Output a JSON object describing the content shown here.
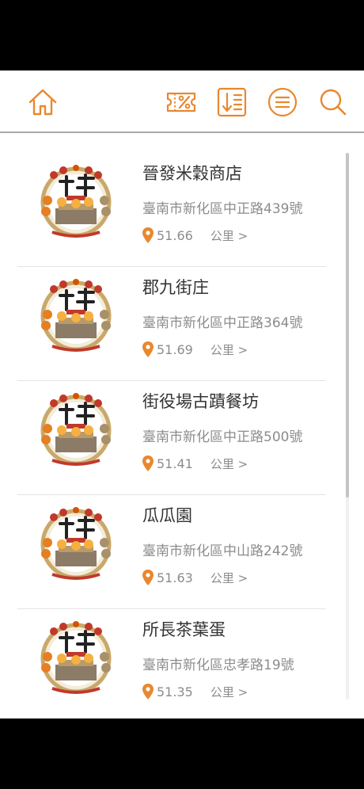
{
  "colors": {
    "accent": "#e8882e",
    "pin": "#e8882e",
    "divider": "#a8a8a8"
  },
  "toolbar": {
    "home_icon": "home-icon",
    "coupon_icon": "coupon-icon",
    "sort_icon": "sort-icon",
    "filter_icon": "filter-icon",
    "search_icon": "search-icon"
  },
  "stores": [
    {
      "name": "晉發米穀商店",
      "address": "臺南市新化區中正路439號",
      "distance": "51.66",
      "unit": "公里 >"
    },
    {
      "name": "郡九街庄",
      "address": "臺南市新化區中正路364號",
      "distance": "51.69",
      "unit": "公里 >"
    },
    {
      "name": "街役場古蹟餐坊",
      "address": "臺南市新化區中正路500號",
      "distance": "51.41",
      "unit": "公里 >"
    },
    {
      "name": "瓜瓜園",
      "address": "臺南市新化區中山路242號",
      "distance": "51.63",
      "unit": "公里 >"
    },
    {
      "name": "所長茶葉蛋",
      "address": "臺南市新化區忠孝路19號",
      "distance": "51.35",
      "unit": "公里 >"
    }
  ],
  "scroll": {
    "position_fraction": 0.0,
    "visible_fraction": 0.63
  }
}
